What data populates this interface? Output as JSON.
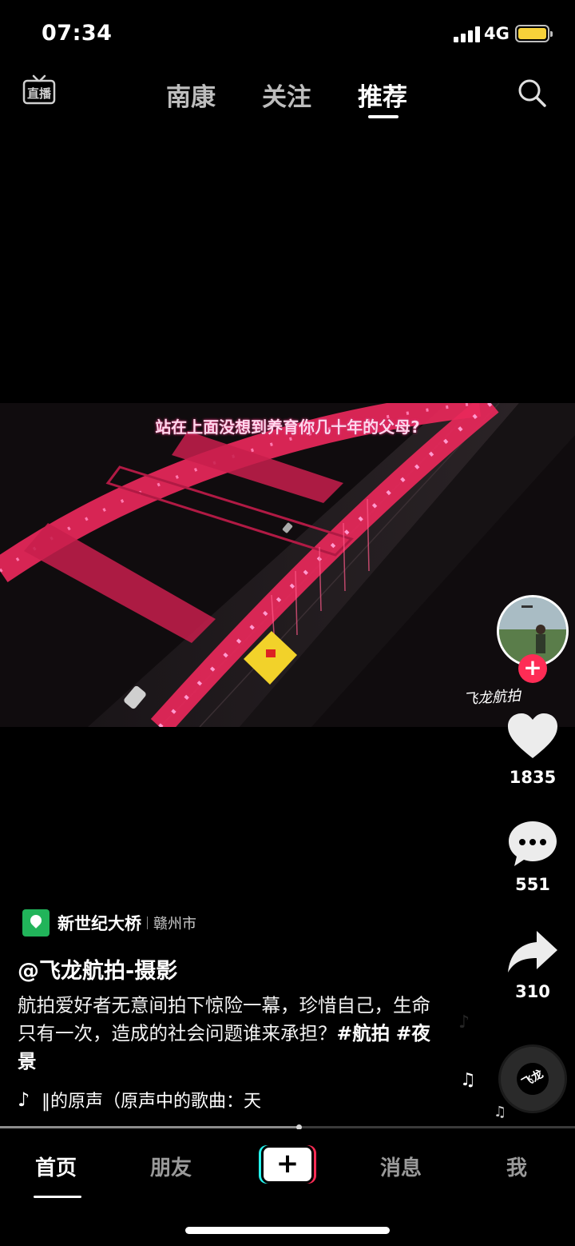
{
  "status_bar": {
    "time": "07:34",
    "network": "4G",
    "battery_color": "#f7d23a"
  },
  "top_nav": {
    "live_label": "直播",
    "tabs": [
      {
        "label": "南康",
        "active": false
      },
      {
        "label": "关注",
        "active": false
      },
      {
        "label": "推荐",
        "active": true
      }
    ],
    "search_icon": "search-icon"
  },
  "video": {
    "subtitle": "站在上面没想到养育你几十年的父母?",
    "watermark": "飞龙航拍"
  },
  "right_rail": {
    "likes": "1835",
    "comments": "551",
    "shares": "310",
    "follow_symbol": "+"
  },
  "info": {
    "location_name": "新世纪大桥",
    "location_city": "赣州市",
    "username": "@飞龙航拍-摄影",
    "caption_text": "航拍爱好者无意间拍下惊险一幕，珍惜自己，生命只有一次，造成的社会问题谁来承担？",
    "hashtags": [
      "#航拍",
      "#夜景"
    ],
    "music_text": "‖的原声（原声中的歌曲：天",
    "disc_text": "飞龙"
  },
  "progress": {
    "fraction": 0.52
  },
  "bottom_nav": {
    "items": [
      {
        "label": "首页",
        "active": true
      },
      {
        "label": "朋友",
        "active": false
      },
      {
        "label": "消息",
        "active": false
      },
      {
        "label": "我",
        "active": false
      }
    ],
    "create_symbol": "+"
  },
  "colors": {
    "accent_red": "#fe2c55",
    "accent_cyan": "#25f4ee",
    "location_green": "#21b45a"
  }
}
